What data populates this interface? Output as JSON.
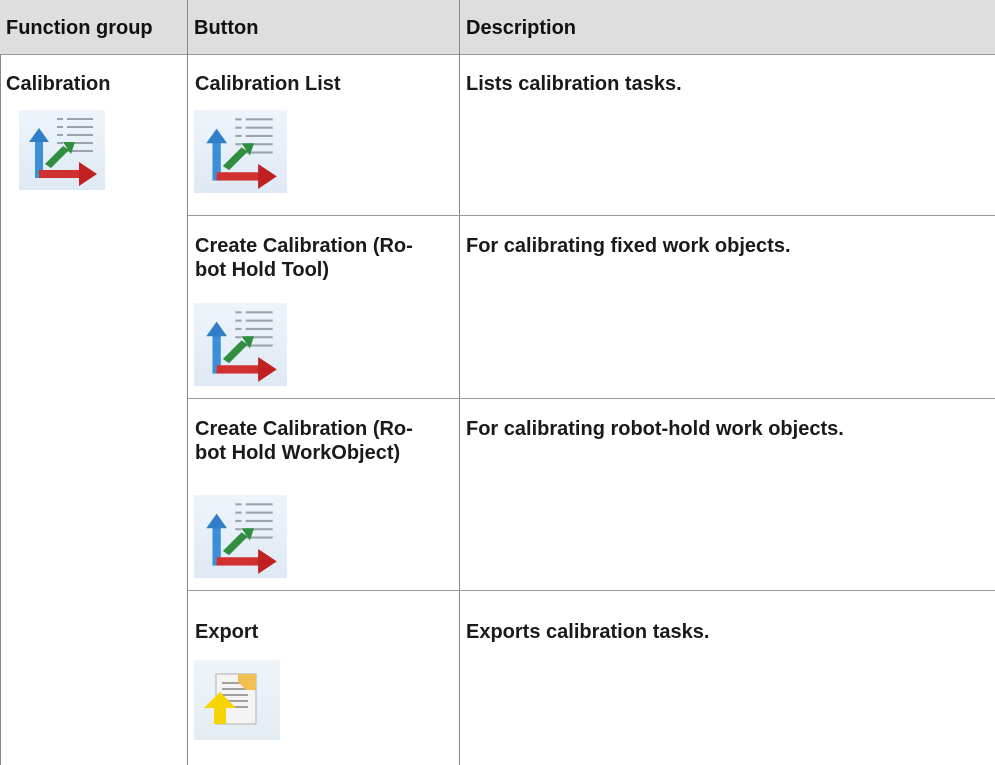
{
  "table": {
    "headers": {
      "function_group": "Function group",
      "button": "Button",
      "description": "Description"
    },
    "function_group": {
      "label": "Calibration",
      "icon": "calibration-icon"
    },
    "rows": [
      {
        "button_line1": "Calibration List",
        "button_line2": "",
        "icon": "calibration-list-icon",
        "description": "Lists calibration tasks."
      },
      {
        "button_line1": "Create Calibration (Ro-",
        "button_line2": "bot Hold Tool)",
        "icon": "calibration-tool-icon",
        "description": "For calibrating fixed work objects."
      },
      {
        "button_line1": "Create Calibration (Ro-",
        "button_line2": "bot Hold WorkObject)",
        "icon": "calibration-workobject-icon",
        "description": "For calibrating robot-hold work objects."
      },
      {
        "button_line1": "Export",
        "button_line2": "",
        "icon": "export-icon",
        "description": "Exports calibration tasks."
      }
    ]
  }
}
